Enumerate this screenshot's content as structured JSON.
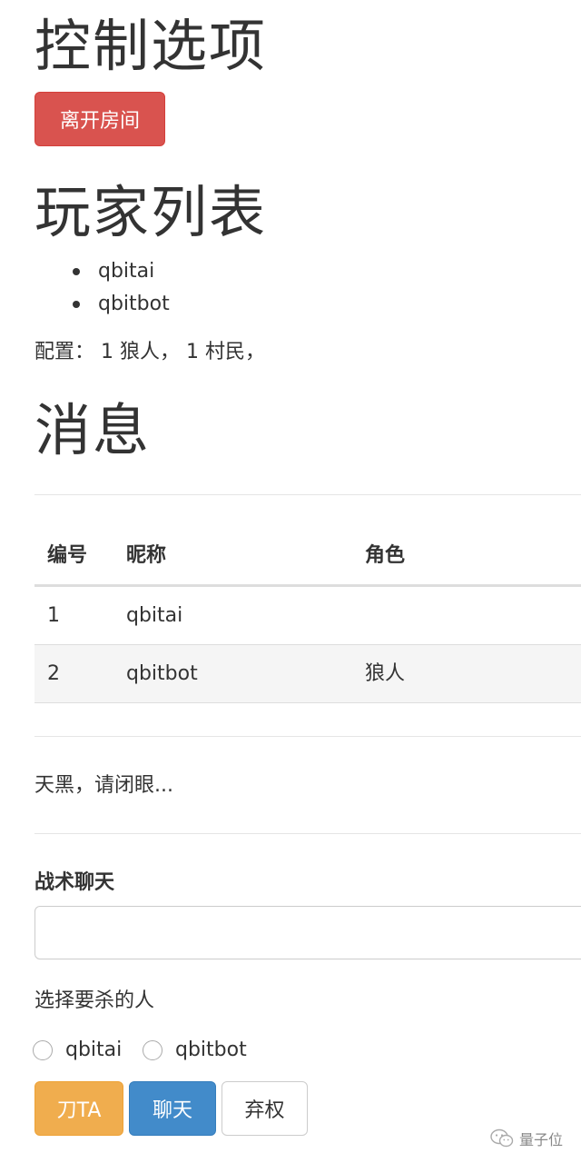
{
  "controls": {
    "title": "控制选项",
    "leave_button": "离开房间"
  },
  "players": {
    "title": "玩家列表",
    "items": [
      "qbitai",
      "qbitbot"
    ],
    "config_text": "配置： 1 狼人， 1 村民，"
  },
  "messages": {
    "title": "消息",
    "table": {
      "headers": [
        "编号",
        "昵称",
        "角色"
      ],
      "rows": [
        [
          "1",
          "qbitai",
          ""
        ],
        [
          "2",
          "qbitbot",
          "狼人"
        ]
      ]
    },
    "night_text": "天黑，请闭眼..."
  },
  "chat": {
    "label": "战术聊天",
    "value": "",
    "placeholder": ""
  },
  "kill_select": {
    "label": "选择要杀的人",
    "options": [
      "qbitai",
      "qbitbot"
    ]
  },
  "actions": {
    "kill": "刀TA",
    "chat": "聊天",
    "abstain": "弃权"
  },
  "watermark": {
    "text": "量子位",
    "icon": "wechat-icon"
  },
  "colors": {
    "danger": "#d9534f",
    "warning": "#f0ad4e",
    "primary": "#428bca"
  }
}
